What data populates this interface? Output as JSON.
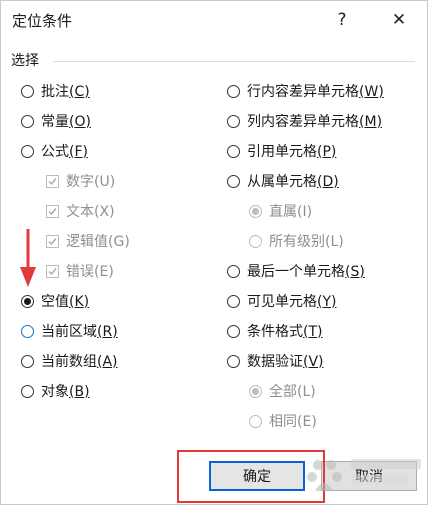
{
  "window": {
    "title": "定位条件",
    "help_label": "?",
    "close_label": "✕"
  },
  "group": {
    "label": "选择"
  },
  "left_options": [
    {
      "text": "批注",
      "key": "C",
      "state": "unchecked",
      "enabled": true
    },
    {
      "text": "常量",
      "key": "O",
      "state": "unchecked",
      "enabled": true
    },
    {
      "text": "公式",
      "key": "F",
      "state": "unchecked",
      "enabled": true
    },
    {
      "text": "数字",
      "key": "U",
      "type": "checkbox",
      "state": "checked",
      "enabled": false
    },
    {
      "text": "文本",
      "key": "X",
      "type": "checkbox",
      "state": "checked",
      "enabled": false
    },
    {
      "text": "逻辑值",
      "key": "G",
      "type": "checkbox",
      "state": "checked",
      "enabled": false
    },
    {
      "text": "错误",
      "key": "E",
      "type": "checkbox",
      "state": "checked",
      "enabled": false
    },
    {
      "text": "空值",
      "key": "K",
      "state": "selected",
      "enabled": true
    },
    {
      "text": "当前区域",
      "key": "R",
      "state": "unchecked",
      "enabled": true
    },
    {
      "text": "当前数组",
      "key": "A",
      "state": "unchecked",
      "enabled": true
    },
    {
      "text": "对象",
      "key": "B",
      "state": "unchecked",
      "enabled": true
    }
  ],
  "right_options": [
    {
      "text": "行内容差异单元格",
      "key": "W",
      "state": "unchecked",
      "enabled": true
    },
    {
      "text": "列内容差异单元格",
      "key": "M",
      "state": "unchecked",
      "enabled": true
    },
    {
      "text": "引用单元格",
      "key": "P",
      "state": "unchecked",
      "enabled": true
    },
    {
      "text": "从属单元格",
      "key": "D",
      "state": "unchecked",
      "enabled": true
    },
    {
      "text": "直属",
      "key": "I",
      "state": "selected",
      "enabled": false
    },
    {
      "text": "所有级别",
      "key": "L",
      "state": "unchecked",
      "enabled": false
    },
    {
      "text": "最后一个单元格",
      "key": "S",
      "state": "unchecked",
      "enabled": true
    },
    {
      "text": "可见单元格",
      "key": "Y",
      "state": "unchecked",
      "enabled": true
    },
    {
      "text": "条件格式",
      "key": "T",
      "state": "unchecked",
      "enabled": true
    },
    {
      "text": "数据验证",
      "key": "V",
      "state": "unchecked",
      "enabled": true
    },
    {
      "text": "全部",
      "key": "L",
      "state": "selected",
      "enabled": false
    },
    {
      "text": "相同",
      "key": "E",
      "state": "unchecked",
      "enabled": false
    }
  ],
  "buttons": {
    "ok_label": "确定",
    "cancel_label": "取消"
  },
  "colors": {
    "annotation_red": "#e23a3a",
    "default_button_border": "#0a64d8",
    "disabled_text": "#8e8e8e"
  }
}
